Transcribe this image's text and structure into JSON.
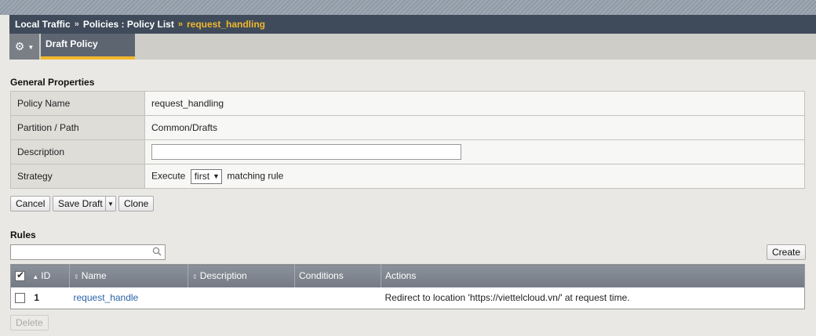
{
  "breadcrumb": {
    "items": [
      "Local Traffic",
      "Policies : Policy List"
    ],
    "current": "request_handling",
    "separator": "»"
  },
  "toolbar": {
    "gear_icon": "gear-icon"
  },
  "tabs": [
    {
      "label": "Draft Policy",
      "active": true
    }
  ],
  "general": {
    "title": "General Properties",
    "rows": {
      "policy_name": {
        "label": "Policy Name",
        "value": "request_handling"
      },
      "partition": {
        "label": "Partition / Path",
        "value": "Common/Drafts"
      },
      "description": {
        "label": "Description",
        "value": ""
      },
      "strategy": {
        "label": "Strategy",
        "prefix": "Execute",
        "selected": "first",
        "suffix": "matching rule"
      }
    }
  },
  "actions": {
    "cancel": "Cancel",
    "save_draft": "Save Draft",
    "clone": "Clone"
  },
  "rules": {
    "title": "Rules",
    "search_value": "",
    "create_label": "Create",
    "columns": [
      "ID",
      "Name",
      "Description",
      "Conditions",
      "Actions"
    ],
    "rows": [
      {
        "id": "1",
        "name": "request_handle",
        "description": "",
        "conditions": "",
        "actions": "Redirect to location 'https://viettelcloud.vn/' at request time."
      }
    ],
    "delete_label": "Delete"
  },
  "colors": {
    "accent": "#f1b82d",
    "header": "#3f4b5a",
    "link": "#2a63a8"
  }
}
